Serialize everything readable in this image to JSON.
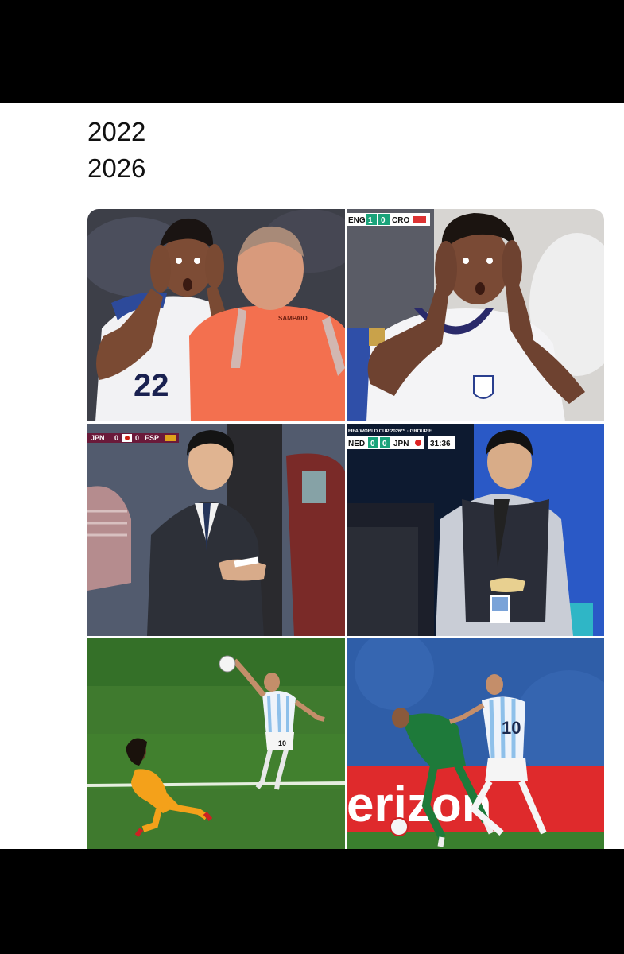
{
  "caption": {
    "line1": "2022",
    "line2": "2026"
  },
  "tiles": [
    {
      "scene": "player-22-hands-on-face-referee",
      "shirt_number": "22",
      "referee_name": "SAMPAIO"
    },
    {
      "scene": "player-hands-on-face",
      "scorebug": {
        "home": "ENG",
        "home_score": "1",
        "away_score": "0",
        "away": "CRO"
      }
    },
    {
      "scene": "coach-writing-notebook-suit",
      "scorebug": {
        "home": "JPN",
        "home_score": "0",
        "away_score": "0",
        "away": "ESP"
      }
    },
    {
      "scene": "coach-writing-notebook-vest",
      "scorebug": {
        "tournament": "FIFA WORLD CUP 2026™ · GROUP F",
        "home": "NED",
        "home_score": "0",
        "away_score": "0",
        "away": "JPN",
        "clock": "31:36"
      }
    },
    {
      "scene": "player-10-skill-move-orange-defender",
      "shirt_number": "10"
    },
    {
      "scene": "player-10-skill-move-green-defender",
      "shirt_number": "10",
      "board_text": "erizon"
    }
  ],
  "colors": {
    "background": "#000000",
    "card": "#ffffff",
    "text": "#111111"
  }
}
